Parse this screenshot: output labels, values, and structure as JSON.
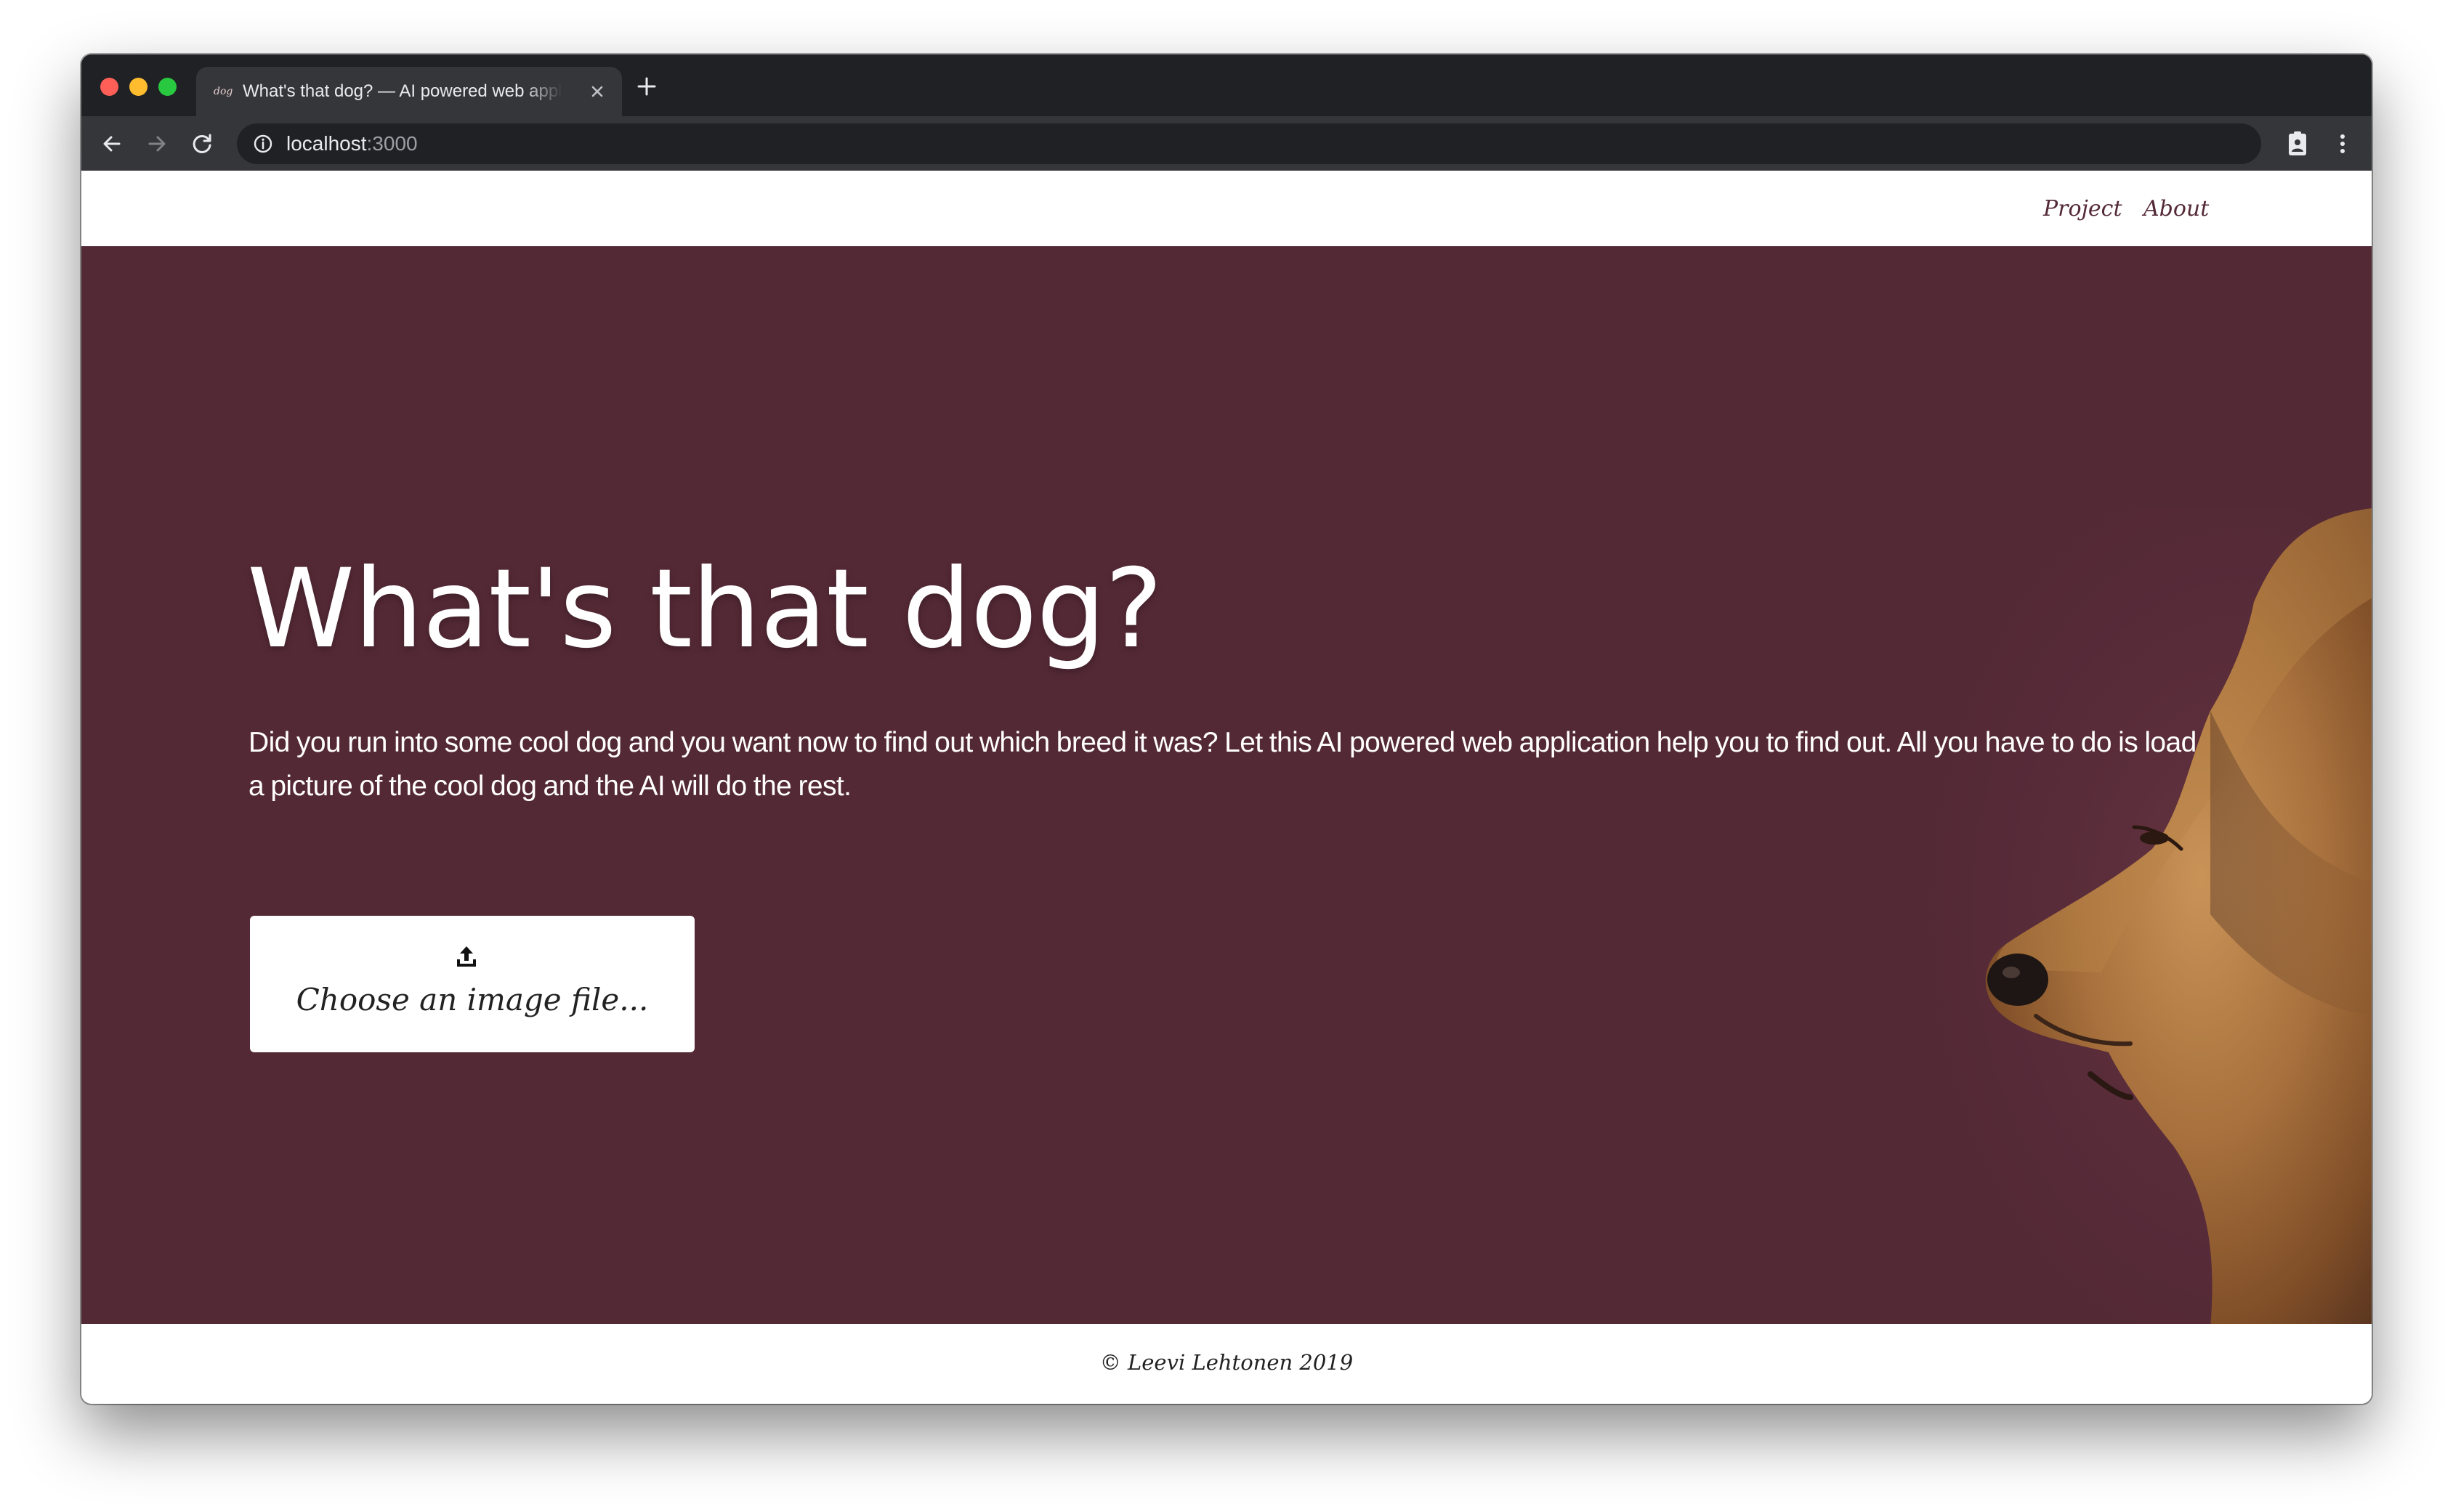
{
  "browser": {
    "tab": {
      "favicon_text": "dog",
      "title": "What's that dog? — AI powered web application"
    },
    "address_bar": {
      "host": "localhost",
      "port": ":3000"
    }
  },
  "site_nav": {
    "links": [
      {
        "label": "Project"
      },
      {
        "label": "About"
      }
    ]
  },
  "hero": {
    "title": "What's that dog?",
    "description": "Did you run into some cool dog and you want now to find out which breed it was? Let this AI powered web application help you to find out. All you have to do is load a picture of the cool dog and the AI will do the rest.",
    "upload_label": "Choose an image file...",
    "upload_icon": "upload-icon",
    "image": "golden-retriever-profile"
  },
  "footer": {
    "text": "© Leevi Lehtonen 2019"
  },
  "colors": {
    "brand": "#542936",
    "nav_link": "#542936",
    "browser_chrome": "#202124",
    "browser_toolbar": "#35363a"
  }
}
